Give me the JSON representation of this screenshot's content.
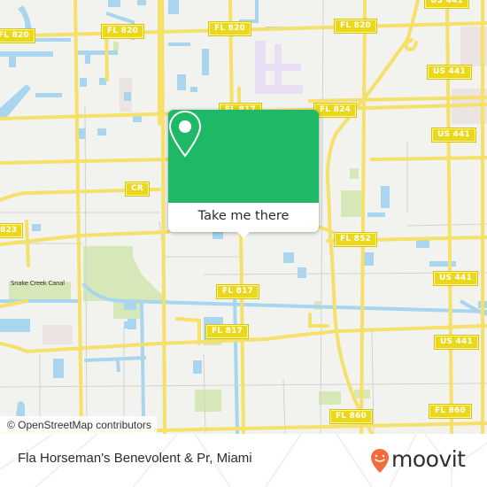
{
  "map": {
    "road_labels": [
      {
        "id": "fl820-west",
        "text": "FL 820"
      },
      {
        "id": "fl820-mid",
        "text": "FL 820"
      },
      {
        "id": "fl820-center",
        "text": "FL 820"
      },
      {
        "id": "fl820-east",
        "text": "FL 820"
      },
      {
        "id": "us441-top",
        "text": "US 441"
      },
      {
        "id": "fl817-top",
        "text": "FL 817"
      },
      {
        "id": "fl824",
        "text": "FL 824"
      },
      {
        "id": "us441-2",
        "text": "US 441"
      },
      {
        "id": "us441-3",
        "text": "US 441"
      },
      {
        "id": "cr-label",
        "text": "CR"
      },
      {
        "id": "fl823",
        "text": "823"
      },
      {
        "id": "fl852",
        "text": "FL 852"
      },
      {
        "id": "us441-4",
        "text": "US 441"
      },
      {
        "id": "fl817-mid",
        "text": "FL 817"
      },
      {
        "id": "fl817-low",
        "text": "FL 817"
      },
      {
        "id": "us441-5",
        "text": "US 441"
      },
      {
        "id": "fl860-mid",
        "text": "FL 860"
      },
      {
        "id": "fl860-east",
        "text": "FL 860"
      }
    ],
    "canal_label": "Snake Creek Canal",
    "attribution": "© OpenStreetMap contributors",
    "colors": {
      "land": "#f2f2ee",
      "road": "#f5e06a",
      "water": "#a9d6ee",
      "park": "#d6e8b8",
      "minor_road": "#cfcfcf"
    }
  },
  "popup": {
    "button_label": "Take me there",
    "icon": "map-pin-icon",
    "accent": "#1fb866"
  },
  "footer": {
    "place_name": "Fla Horseman's Benevolent & Pr, Miami",
    "logo_text": "moovit",
    "logo_color": "#f26b3a"
  }
}
